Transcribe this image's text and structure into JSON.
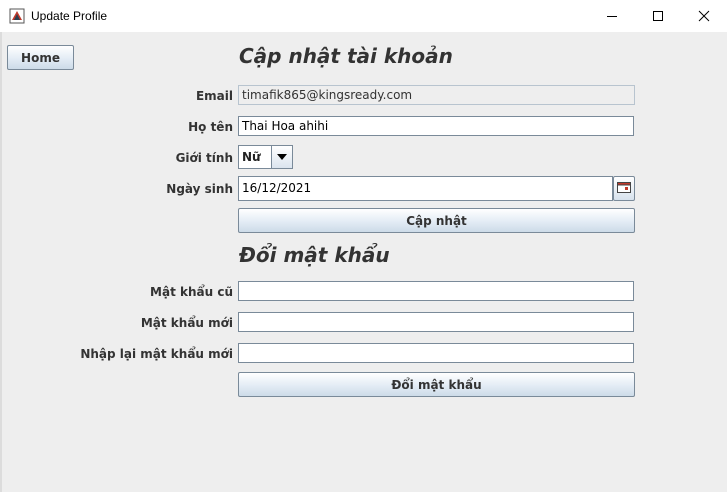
{
  "window": {
    "title": "Update Profile",
    "icons": {
      "app": "app-java-icon",
      "minimize": "minimize-icon",
      "maximize": "maximize-icon",
      "close": "close-icon"
    }
  },
  "nav": {
    "home_label": "Home"
  },
  "profile": {
    "heading": "Cập nhật tài khoản",
    "email_label": "Email",
    "email_value": "timafik865@kingsready.com",
    "name_label": "Họ tên",
    "name_value": "Thai Hoa ahihi",
    "gender_label": "Giới tính",
    "gender_value": "Nữ",
    "dob_label": "Ngày sinh",
    "dob_value": "16/12/2021",
    "calendar_icon": "calendar-icon",
    "submit_label": "Cập nhật"
  },
  "password": {
    "heading": "Đổi mật khẩu",
    "old_label": "Mật khẩu cũ",
    "old_value": "",
    "new_label": "Mật khẩu mới",
    "new_value": "",
    "confirm_label": "Nhập lại mật khẩu mới",
    "confirm_value": "",
    "submit_label": "Đổi mật khẩu"
  }
}
